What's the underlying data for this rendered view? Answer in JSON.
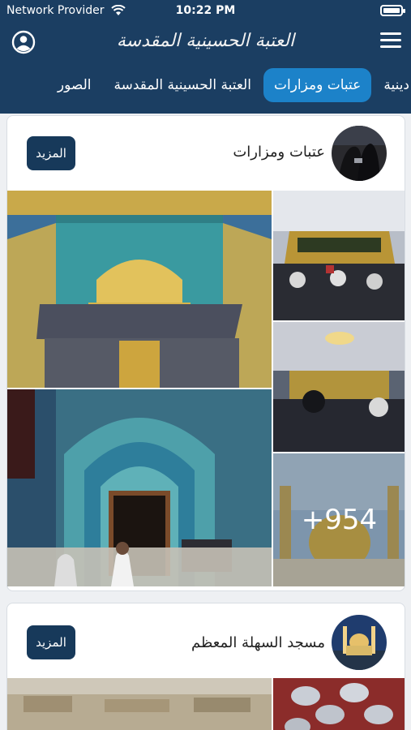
{
  "status": {
    "carrier": "Network Provider",
    "time": "10:22 PM"
  },
  "header": {
    "logo_text": "العتبة الحسينية المقدسة"
  },
  "tabs": [
    {
      "label": "الصور"
    },
    {
      "label": "العتبة الحسينية المقدسة"
    },
    {
      "label": "عتبات ومزارات"
    },
    {
      "label": "عتبات دينية"
    }
  ],
  "active_tab_index": 2,
  "cards": [
    {
      "title": "عتبات ومزارات",
      "more_label": "المزيد",
      "extra_count": "+954"
    },
    {
      "title": "مسجد السهلة المعظم",
      "more_label": "المزيد"
    }
  ],
  "colors": {
    "header_bg": "#1b3e62",
    "active_tab": "#1c82c9",
    "more_button": "#17395a"
  }
}
